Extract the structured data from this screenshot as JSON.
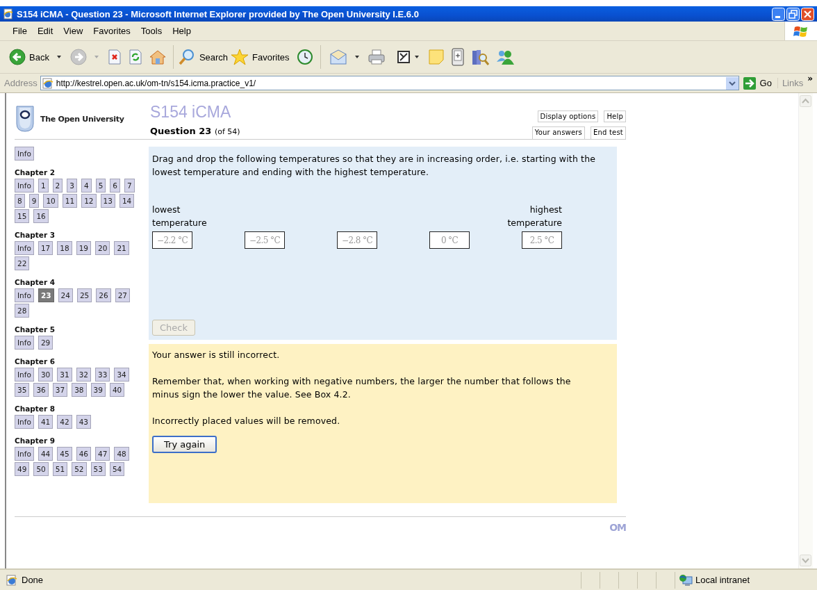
{
  "window": {
    "title": "S154 iCMA - Question 23 - Microsoft Internet Explorer provided by The Open University I.E.6.0"
  },
  "menu": [
    "File",
    "Edit",
    "View",
    "Favorites",
    "Tools",
    "Help"
  ],
  "toolbar": {
    "back": "Back",
    "search": "Search",
    "favorites": "Favorites"
  },
  "address": {
    "label": "Address",
    "url": "http://kestrel.open.ac.uk/om-tn/s154.icma.practice_v1/",
    "go": "Go",
    "links": "Links",
    "more": "»"
  },
  "page": {
    "logo_text": "The Open University",
    "course": "S154 iCMA",
    "question": "Question 23",
    "question_total": "(of 54)",
    "header_buttons_top": [
      "Display options",
      "Help"
    ],
    "header_buttons_bottom": [
      "Your answers",
      "End test"
    ],
    "footer_logo": "OM"
  },
  "nav": {
    "info": "Info",
    "chapters": [
      {
        "title": "Chapter 2",
        "items": [
          {
            "label": "Info",
            "selected": false
          },
          {
            "label": "1",
            "selected": false
          },
          {
            "label": "2",
            "selected": false
          },
          {
            "label": "3",
            "selected": false
          },
          {
            "label": "4",
            "selected": false
          },
          {
            "label": "5",
            "selected": false
          },
          {
            "label": "6",
            "selected": false
          },
          {
            "label": "7",
            "selected": false
          },
          {
            "label": "8",
            "selected": false
          },
          {
            "label": "9",
            "selected": false
          },
          {
            "label": "10",
            "selected": false
          },
          {
            "label": "11",
            "selected": false
          },
          {
            "label": "12",
            "selected": false
          },
          {
            "label": "13",
            "selected": false
          },
          {
            "label": "14",
            "selected": false
          },
          {
            "label": "15",
            "selected": false
          },
          {
            "label": "16",
            "selected": false
          }
        ]
      },
      {
        "title": "Chapter 3",
        "items": [
          {
            "label": "Info",
            "selected": false
          },
          {
            "label": "17",
            "selected": false
          },
          {
            "label": "18",
            "selected": false
          },
          {
            "label": "19",
            "selected": false
          },
          {
            "label": "20",
            "selected": false
          },
          {
            "label": "21",
            "selected": false
          },
          {
            "label": "22",
            "selected": false
          }
        ]
      },
      {
        "title": "Chapter 4",
        "items": [
          {
            "label": "Info",
            "selected": false
          },
          {
            "label": "23",
            "selected": true
          },
          {
            "label": "24",
            "selected": false
          },
          {
            "label": "25",
            "selected": false
          },
          {
            "label": "26",
            "selected": false
          },
          {
            "label": "27",
            "selected": false
          },
          {
            "label": "28",
            "selected": false
          }
        ]
      },
      {
        "title": "Chapter 5",
        "items": [
          {
            "label": "Info",
            "selected": false
          },
          {
            "label": "29",
            "selected": false
          }
        ]
      },
      {
        "title": "Chapter 6",
        "items": [
          {
            "label": "Info",
            "selected": false
          },
          {
            "label": "30",
            "selected": false
          },
          {
            "label": "31",
            "selected": false
          },
          {
            "label": "32",
            "selected": false
          },
          {
            "label": "33",
            "selected": false
          },
          {
            "label": "34",
            "selected": false
          },
          {
            "label": "35",
            "selected": false
          },
          {
            "label": "36",
            "selected": false
          },
          {
            "label": "37",
            "selected": false
          },
          {
            "label": "38",
            "selected": false
          },
          {
            "label": "39",
            "selected": false
          },
          {
            "label": "40",
            "selected": false
          }
        ]
      },
      {
        "title": "Chapter 8",
        "items": [
          {
            "label": "Info",
            "selected": false
          },
          {
            "label": "41",
            "selected": false
          },
          {
            "label": "42",
            "selected": false
          },
          {
            "label": "43",
            "selected": false
          }
        ]
      },
      {
        "title": "Chapter 9",
        "items": [
          {
            "label": "Info",
            "selected": false
          },
          {
            "label": "44",
            "selected": false
          },
          {
            "label": "45",
            "selected": false
          },
          {
            "label": "46",
            "selected": false
          },
          {
            "label": "47",
            "selected": false
          },
          {
            "label": "48",
            "selected": false
          },
          {
            "label": "49",
            "selected": false
          },
          {
            "label": "50",
            "selected": false
          },
          {
            "label": "51",
            "selected": false
          },
          {
            "label": "52",
            "selected": false
          },
          {
            "label": "53",
            "selected": false
          },
          {
            "label": "54",
            "selected": false
          }
        ]
      }
    ]
  },
  "question": {
    "prompt": "Drag and drop the following temperatures so that they are in increasing order, i.e. starting with the lowest temperature and ending with the highest temperature.",
    "lowest_label": "lowest temperature",
    "highest_label": "highest temperature",
    "slots": [
      "−2.2 °C",
      "−2.5 °C",
      "−2.8 °C",
      "0 °C",
      "2.5 °C"
    ],
    "check": {
      "label": "Check",
      "disabled": true
    }
  },
  "feedback": {
    "paragraphs": [
      "Your answer is still incorrect.",
      "Remember that, when working with negative numbers, the larger the number that follows the minus sign the lower the value. See Box 4.2.",
      "Incorrectly placed values will be removed."
    ],
    "button": "Try again"
  },
  "status_bar": {
    "text": "Done",
    "zone": "Local intranet"
  }
}
